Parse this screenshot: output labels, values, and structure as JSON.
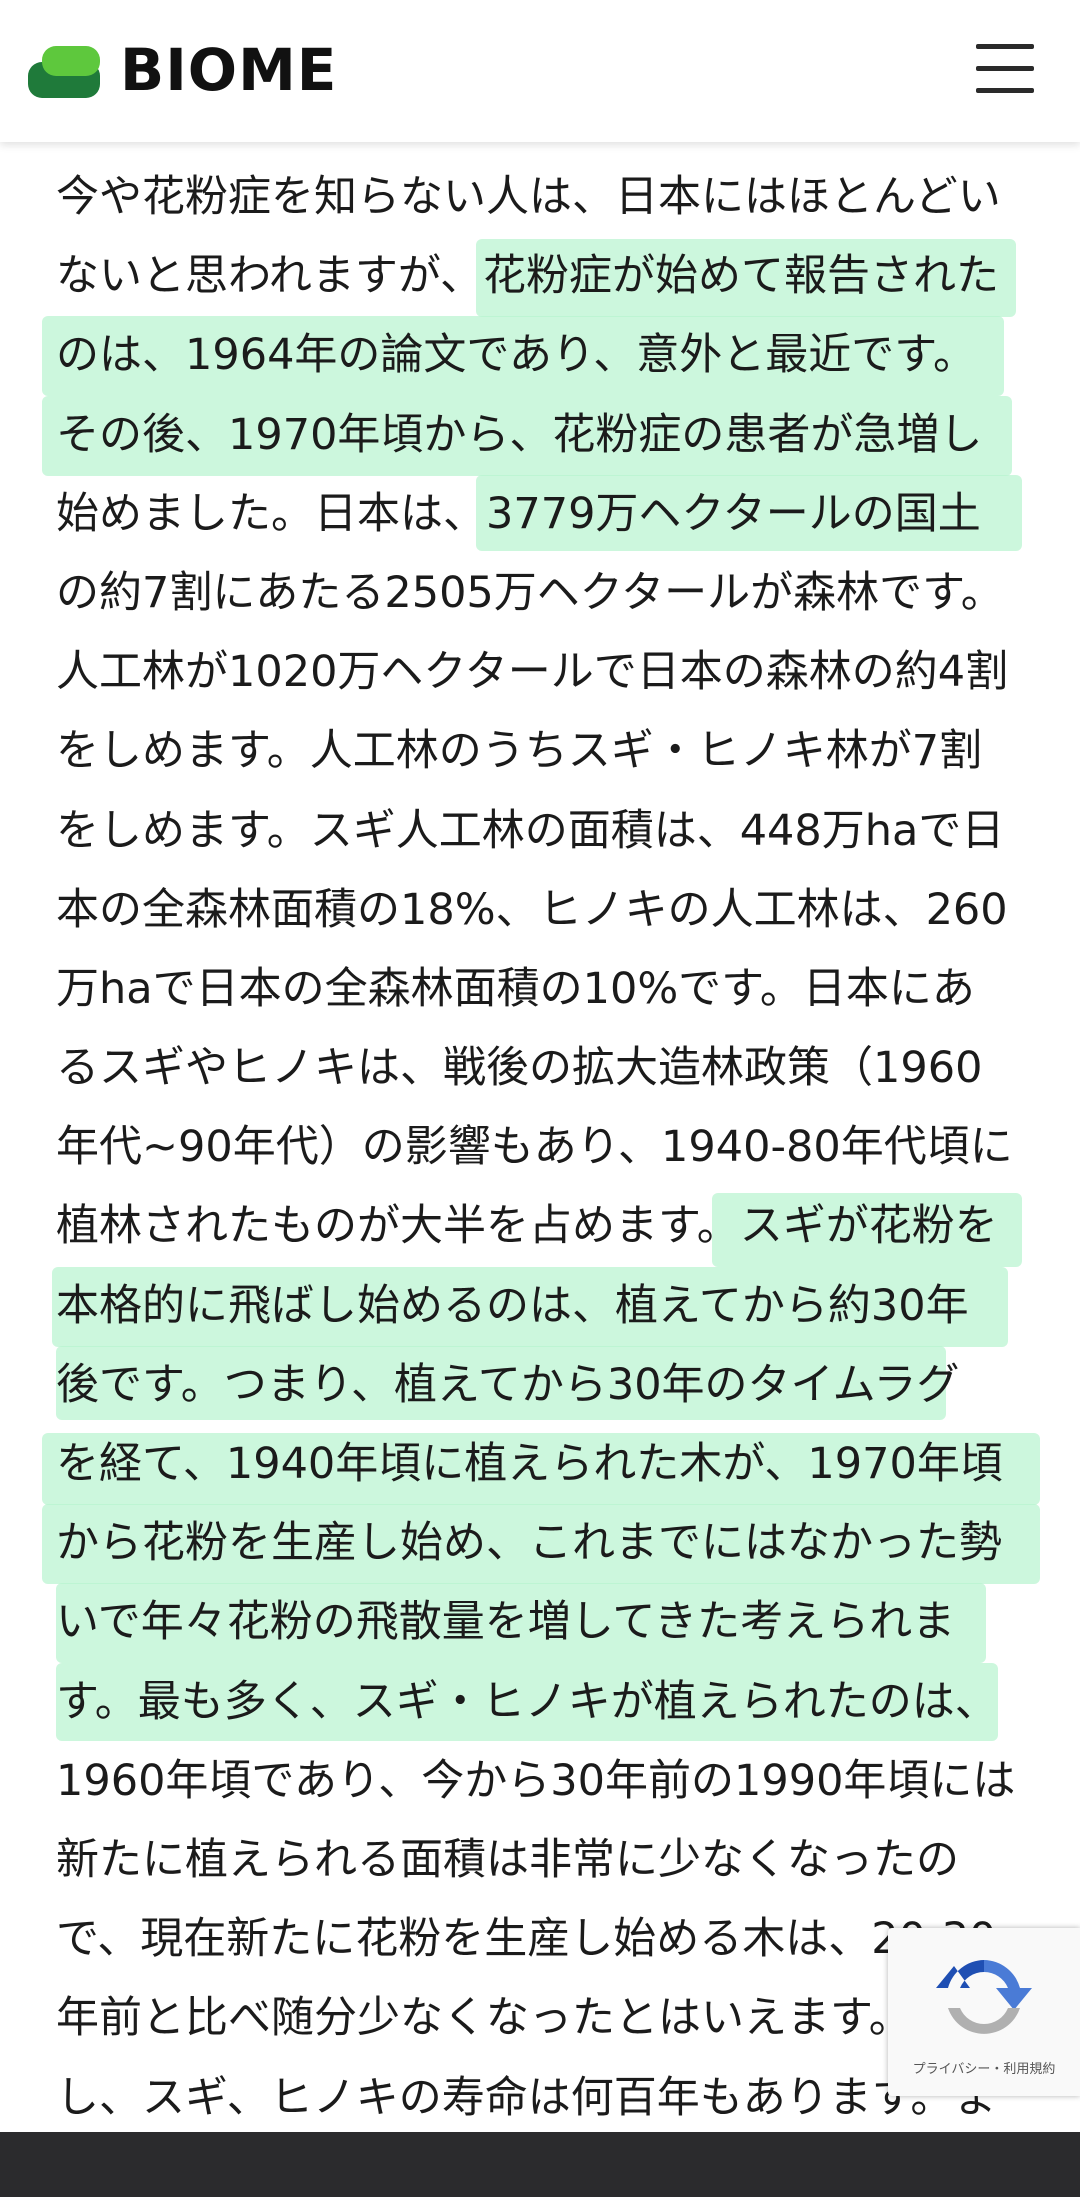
{
  "header": {
    "logo_text": "BIOME"
  },
  "article": {
    "lines": [
      "今や花粉症を知らない人は、日本にはほとんどい",
      "ないと思われますが、花粉症が始めて報告された",
      "のは、1964年の論文であり、意外と最近です。",
      "その後、1970年頃から、花粉症の患者が急増し",
      "始めました。日本は、3779万ヘクタールの国土",
      "の約7割にあたる2505万ヘクタールが森林です。",
      "人工林が1020万ヘクタールで日本の森林の約4割",
      "をしめます。人工林のうちスギ・ヒノキ林が7割",
      "をしめます。スギ人工林の面積は、448万haで日",
      "本の全森林面積の18%、ヒノキの人工林は、260",
      "万haで日本の全森林面積の10%です。日本にあ",
      "るスギやヒノキは、戦後の拡大造林政策（1960",
      "年代~90年代）の影響もあり、1940-80年代頃に",
      "植林されたものが大半を占めます。スギが花粉を",
      "本格的に飛ばし始めるのは、植えてから約30年",
      "後です。つまり、植えてから30年のタイムラグ",
      "を経て、1940年頃に植えられた木が、1970年頃",
      "から花粉を生産し始め、これまでにはなかった勢",
      "いで年々花粉の飛散量を増してきた考えられま",
      "す。最も多く、スギ・ヒノキが植えられたのは、",
      "1960年頃であり、今から30年前の1990年頃には",
      "新たに植えられる面積は非常に少なくなったの",
      "で、現在新たに花粉を生産し始める木は、20-30",
      "年前と比べ随分少なくなったとはいえます。しか",
      "し、スギ、ヒノキの寿命は何百年もあります。ま"
    ]
  },
  "recaptcha": {
    "label": "プライバシー・利用規約"
  },
  "colors": {
    "highlight": "#b6f3cf",
    "footer": "#2b2b2d",
    "logo_dark": "#1f7a3a",
    "logo_light": "#5ec83d"
  }
}
